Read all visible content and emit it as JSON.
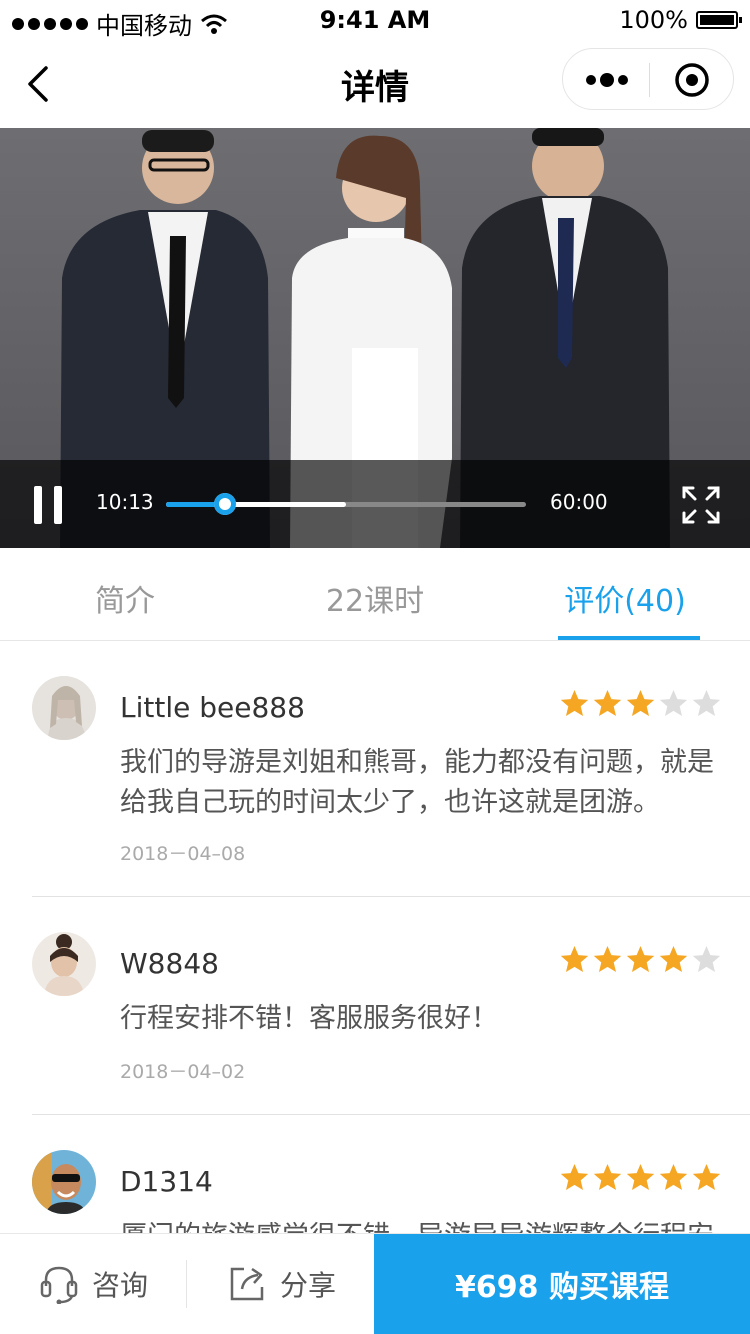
{
  "status_bar": {
    "carrier": "中国移动",
    "time": "9:41 AM",
    "battery": "100%"
  },
  "nav": {
    "title": "详情"
  },
  "video": {
    "current_time": "10:13",
    "duration": "60:00",
    "progress": 0.165,
    "buffered": 0.5
  },
  "tabs": [
    {
      "label": "简介",
      "active": false
    },
    {
      "label": "22课时",
      "active": false
    },
    {
      "label": "评价(40)",
      "active": true
    }
  ],
  "reviews": [
    {
      "name": "Little bee888",
      "rating": 3,
      "text": "我们的导游是刘姐和熊哥，能力都没有问题，就是给我自己玩的时间太少了，也许这就是团游。",
      "date": "2018－04–08"
    },
    {
      "name": "W8848",
      "rating": 4,
      "text": "行程安排不错！客服服务很好！",
      "date": "2018－04–02"
    },
    {
      "name": "D1314",
      "rating": 5,
      "text": "厦门的旅游感觉很不错，导游导导游辉整个行程安",
      "date": ""
    }
  ],
  "bottom_bar": {
    "consult_label": "咨询",
    "share_label": "分享",
    "buy_label": "¥698 购买课程"
  },
  "colors": {
    "accent": "#1aa1ec",
    "star_on": "#f5a623",
    "star_off": "#dddddd"
  }
}
